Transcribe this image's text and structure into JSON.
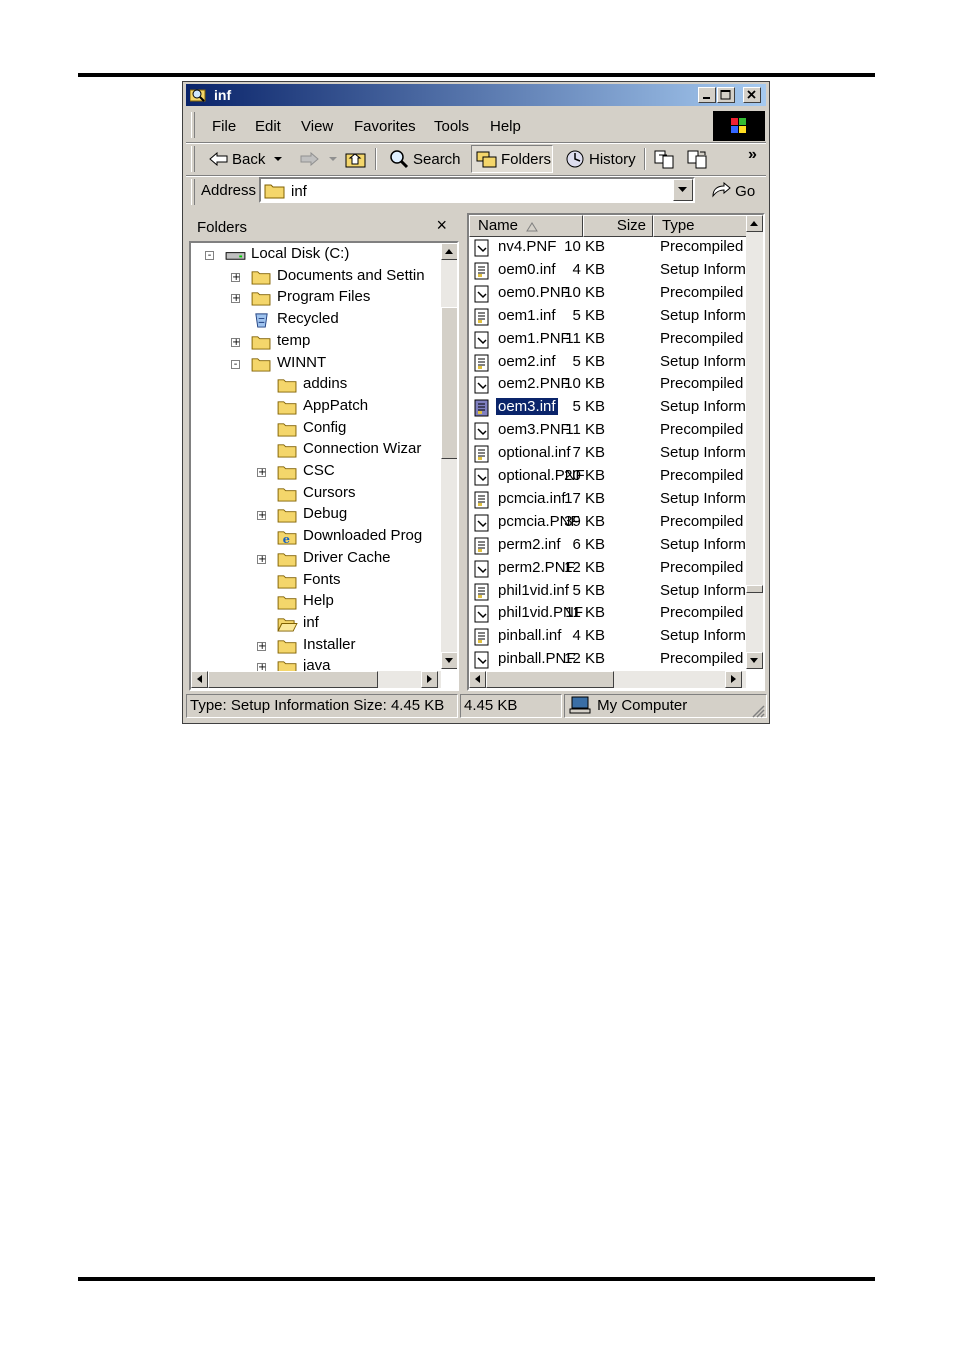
{
  "window": {
    "title": "inf"
  },
  "menu": [
    "File",
    "Edit",
    "View",
    "Favorites",
    "Tools",
    "Help"
  ],
  "toolbar": {
    "back": "Back",
    "search": "Search",
    "folders": "Folders",
    "history": "History",
    "more": "»"
  },
  "address": {
    "label": "Address",
    "value": "inf",
    "go": "Go"
  },
  "folders_pane": {
    "title": "Folders",
    "close": "×",
    "items": [
      {
        "label": "Local Disk (C:)",
        "level": 1,
        "expander": "-"
      },
      {
        "label": "Documents and Settin",
        "level": 2,
        "expander": "+"
      },
      {
        "label": "Program Files",
        "level": 2,
        "expander": "+"
      },
      {
        "label": "Recycled",
        "level": 2,
        "expander": ""
      },
      {
        "label": "temp",
        "level": 2,
        "expander": "+"
      },
      {
        "label": "WINNT",
        "level": 2,
        "expander": "-"
      },
      {
        "label": "addins",
        "level": 3,
        "expander": ""
      },
      {
        "label": "AppPatch",
        "level": 3,
        "expander": ""
      },
      {
        "label": "Config",
        "level": 3,
        "expander": ""
      },
      {
        "label": "Connection Wizar",
        "level": 3,
        "expander": ""
      },
      {
        "label": "CSC",
        "level": 3,
        "expander": "+"
      },
      {
        "label": "Cursors",
        "level": 3,
        "expander": ""
      },
      {
        "label": "Debug",
        "level": 3,
        "expander": "+"
      },
      {
        "label": "Downloaded Prog",
        "level": 3,
        "expander": ""
      },
      {
        "label": "Driver Cache",
        "level": 3,
        "expander": "+"
      },
      {
        "label": "Fonts",
        "level": 3,
        "expander": ""
      },
      {
        "label": "Help",
        "level": 3,
        "expander": ""
      },
      {
        "label": "inf",
        "level": 3,
        "expander": ""
      },
      {
        "label": "Installer",
        "level": 3,
        "expander": "+"
      },
      {
        "label": "java",
        "level": 3,
        "expander": "+"
      }
    ]
  },
  "files_pane": {
    "columns": [
      "Name",
      "Size",
      "Type"
    ],
    "rows": [
      {
        "name": "nv4.PNF",
        "size": "10 KB",
        "type": "Precompiled"
      },
      {
        "name": "oem0.inf",
        "size": "4 KB",
        "type": "Setup Inform"
      },
      {
        "name": "oem0.PNF",
        "size": "10 KB",
        "type": "Precompiled"
      },
      {
        "name": "oem1.inf",
        "size": "5 KB",
        "type": "Setup Inform"
      },
      {
        "name": "oem1.PNF",
        "size": "11 KB",
        "type": "Precompiled"
      },
      {
        "name": "oem2.inf",
        "size": "5 KB",
        "type": "Setup Inform"
      },
      {
        "name": "oem2.PNF",
        "size": "10 KB",
        "type": "Precompiled"
      },
      {
        "name": "oem3.inf",
        "size": "5 KB",
        "type": "Setup Inform",
        "selected": true
      },
      {
        "name": "oem3.PNF",
        "size": "11 KB",
        "type": "Precompiled"
      },
      {
        "name": "optional.inf",
        "size": "7 KB",
        "type": "Setup Inform"
      },
      {
        "name": "optional.PNF",
        "size": "20 KB",
        "type": "Precompiled"
      },
      {
        "name": "pcmcia.inf",
        "size": "17 KB",
        "type": "Setup Inform"
      },
      {
        "name": "pcmcia.PNF",
        "size": "39 KB",
        "type": "Precompiled"
      },
      {
        "name": "perm2.inf",
        "size": "6 KB",
        "type": "Setup Inform"
      },
      {
        "name": "perm2.PNF",
        "size": "12 KB",
        "type": "Precompiled"
      },
      {
        "name": "phil1vid.inf",
        "size": "5 KB",
        "type": "Setup Inform"
      },
      {
        "name": "phil1vid.PNF",
        "size": "11 KB",
        "type": "Precompiled"
      },
      {
        "name": "pinball.inf",
        "size": "4 KB",
        "type": "Setup Inform"
      },
      {
        "name": "pinball.PNF",
        "size": "12 KB",
        "type": "Precompiled"
      }
    ]
  },
  "status": {
    "info": "Type: Setup Information Size: 4.45 KB",
    "size": "4.45 KB",
    "zone": "My Computer"
  }
}
